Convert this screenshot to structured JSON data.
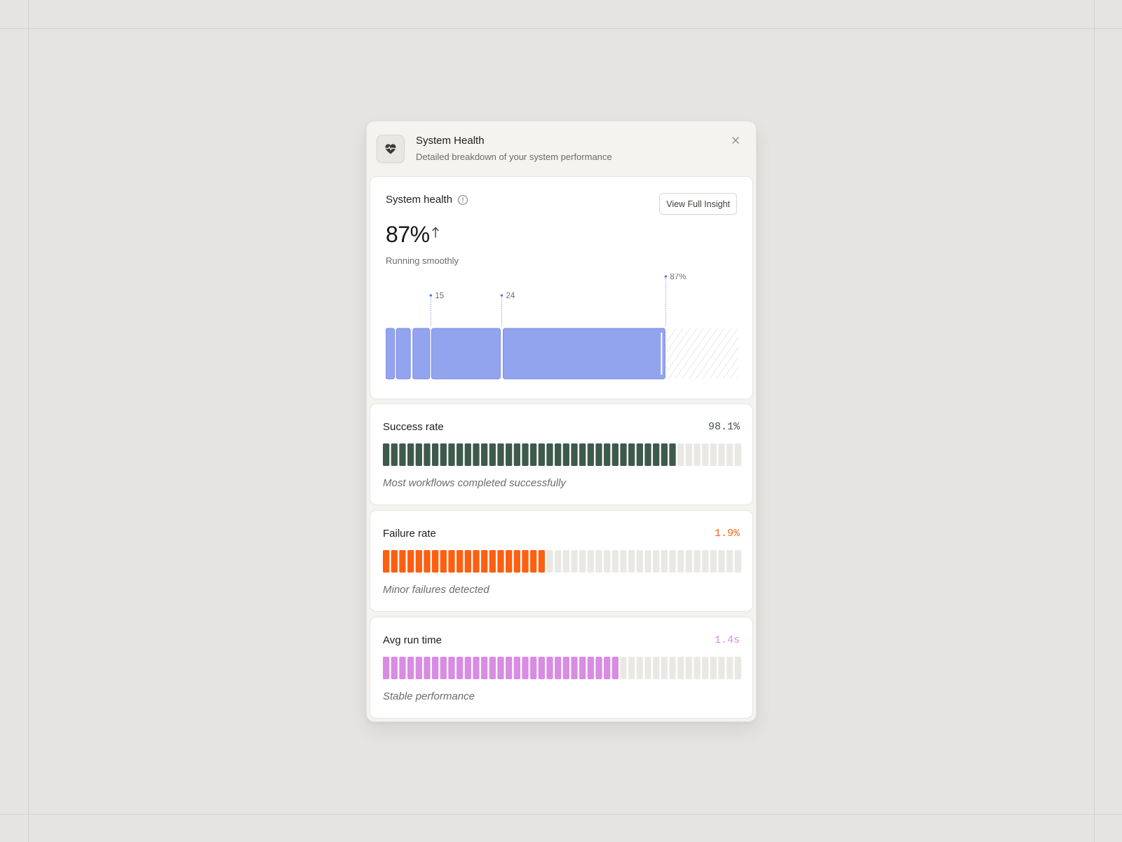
{
  "header": {
    "icon": "heart-pulse-icon",
    "title": "System Health",
    "subtitle": "Detailed breakdown of your system performance",
    "close_icon": "close-icon"
  },
  "health": {
    "title": "System health",
    "info_icon": "info-icon",
    "insight_button": "View Full Insight",
    "value": "87%",
    "trend_icon": "arrow-up-icon",
    "status": "Running smoothly",
    "chart_data": {
      "type": "bar",
      "segment_color": "#93a4ef",
      "segment_border": "#7a8ae6",
      "marker_color": "#6274df",
      "segments": [
        {
          "start": 0,
          "end": 2.5
        },
        {
          "start": 3,
          "end": 7
        },
        {
          "start": 7.7,
          "end": 12.5
        },
        {
          "start": 13,
          "end": 32.5
        },
        {
          "start": 33.3,
          "end": 79.2
        }
      ],
      "remaining": {
        "start": 79.6,
        "end": 100,
        "pattern": "hatched"
      },
      "markers": [
        {
          "at": 12.8,
          "label": "15"
        },
        {
          "at": 32.9,
          "label": "24"
        },
        {
          "at": 79.4,
          "label": "87%"
        }
      ]
    }
  },
  "metrics": [
    {
      "title": "Success rate",
      "value": "98.1%",
      "description": "Most workflows completed successfully",
      "color": "#3e5a4c",
      "value_color": "#44544c",
      "segments_total": 44,
      "segments_filled": 36
    },
    {
      "title": "Failure rate",
      "value": "1.9%",
      "description": "Minor failures detected",
      "color": "#fd5f11",
      "value_color": "#fd5f11",
      "segments_total": 44,
      "segments_filled": 20
    },
    {
      "title": "Avg run time",
      "value": "1.4s",
      "description": "Stable performance",
      "color": "#d88ce3",
      "value_color": "#d88ce3",
      "segments_total": 44,
      "segments_filled": 29
    }
  ],
  "colors": {
    "background": "#e5e4e2",
    "panel": "#f4f3ef",
    "card": "#ffffff",
    "empty_segment": "#e9e8e5"
  }
}
